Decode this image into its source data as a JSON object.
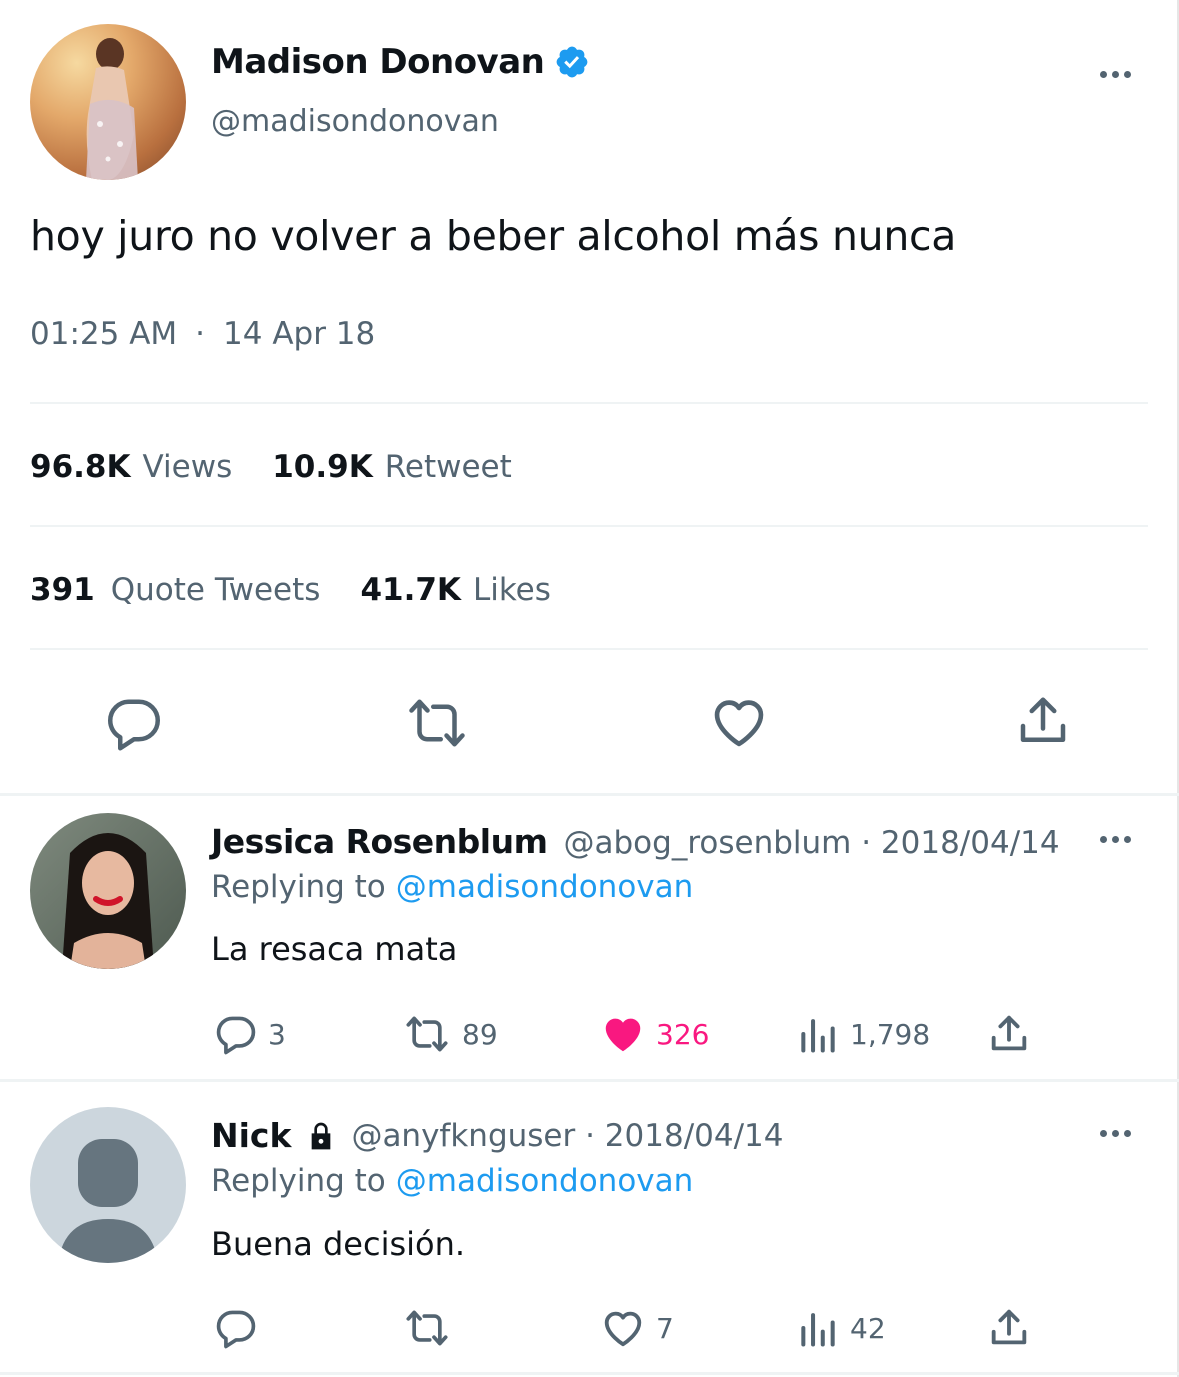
{
  "tweet": {
    "author_name": "Madison Donovan",
    "author_handle": "@madisondonovan",
    "text": "hoy juro no volver a beber alcohol más nunca",
    "time": "01:25 AM",
    "dot": "·",
    "date": "14 Apr 18",
    "stats": {
      "views_count": "96.8K",
      "views_label": "Views",
      "retweets_count": "10.9K",
      "retweets_label": "Retweet",
      "quotes_count": "391",
      "quotes_label": "Quote Tweets",
      "likes_count": "41.7K",
      "likes_label": "Likes"
    },
    "icons": [
      "reply-icon",
      "retweet-icon",
      "like-icon",
      "share-icon"
    ],
    "accent_color": "#1d9bf0"
  },
  "replies": [
    {
      "name": "Jessica Rosenblum",
      "handle_date": "@abog_rosenblum · 2018/04/14",
      "replying_label": "Replying to",
      "replying_handle": "@madisondonovan",
      "text": "La resaca mata",
      "replies": "3",
      "retweets": "89",
      "likes": "326",
      "views": "1,798",
      "liked": true,
      "like_color": "#f91880"
    },
    {
      "name": "Nick",
      "handle_date": "@anyfknguser · 2018/04/14",
      "replying_label": "Replying to",
      "replying_handle": "@madisondonovan",
      "text": "Buena decisión.",
      "likes": "7",
      "views": "42",
      "protected": true
    }
  ]
}
